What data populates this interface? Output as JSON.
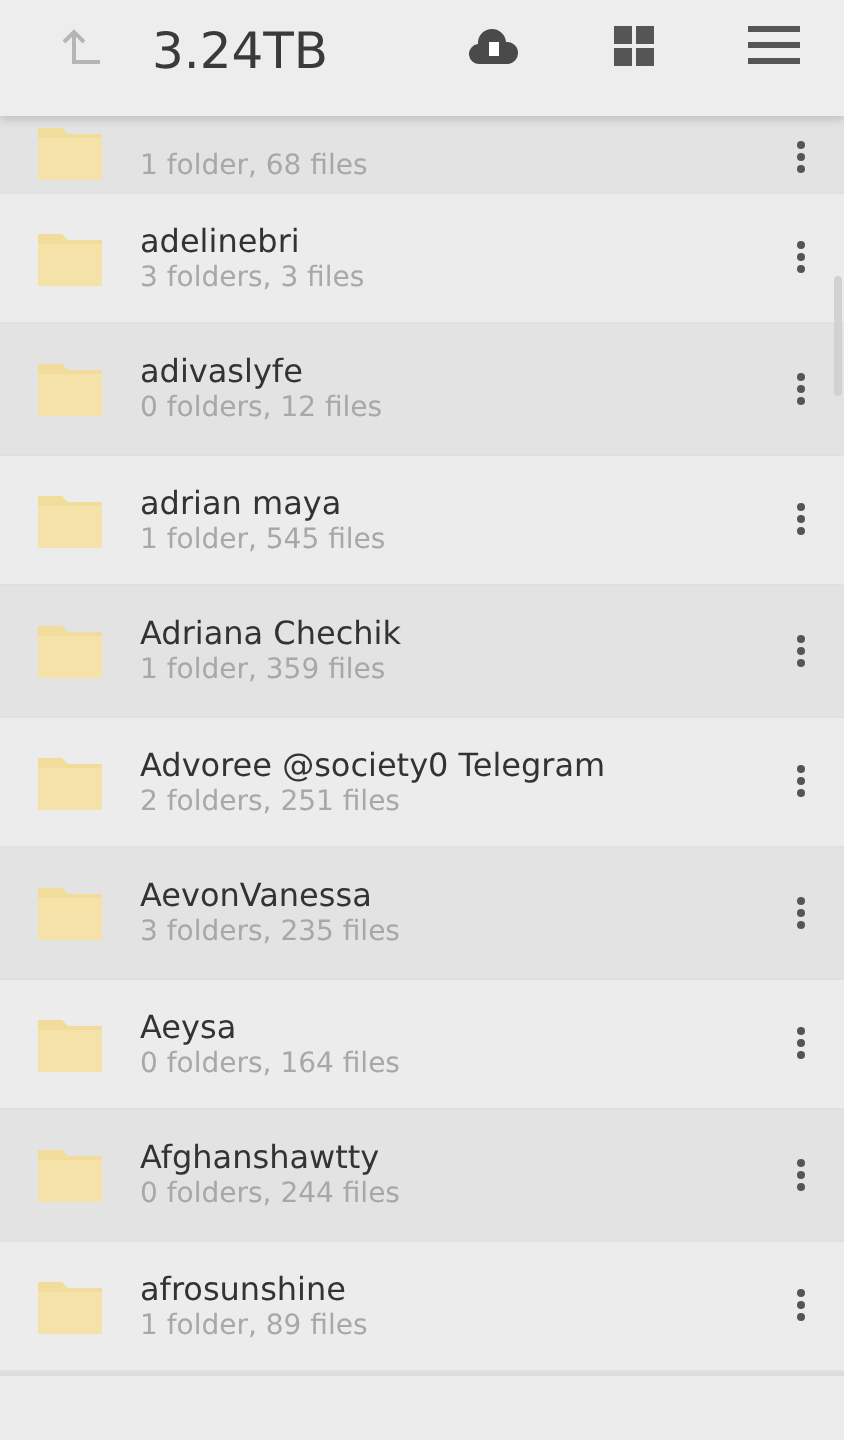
{
  "header": {
    "title": "3.24TB"
  },
  "folders": [
    {
      "detail": "1 folder, 68 files"
    },
    {
      "name": "adelinebri",
      "detail": "3 folders, 3 files"
    },
    {
      "name": "adivaslyfe",
      "detail": "0 folders, 12 files"
    },
    {
      "name": "adrian maya",
      "detail": "1 folder, 545 files"
    },
    {
      "name": "Adriana Chechik",
      "detail": "1 folder, 359 files"
    },
    {
      "name": "Advoree @society0 Telegram",
      "detail": "2 folders, 251 files"
    },
    {
      "name": "AevonVanessa",
      "detail": "3 folders, 235 files"
    },
    {
      "name": "Aeysa",
      "detail": "0 folders, 164 files"
    },
    {
      "name": "Afghanshawtty",
      "detail": "0 folders, 244 files"
    },
    {
      "name": "afrosunshine",
      "detail": "1 folder, 89 files"
    }
  ]
}
